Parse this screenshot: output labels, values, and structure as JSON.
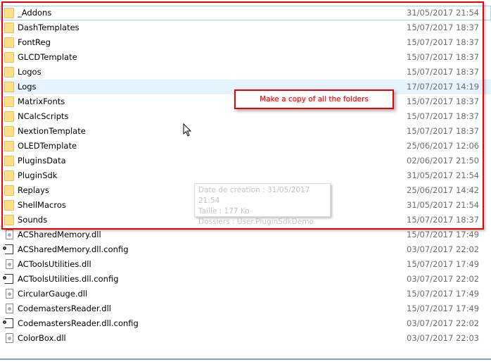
{
  "items": [
    {
      "name": "_Addons",
      "date": "31/05/2017 21:54",
      "type": "folder"
    },
    {
      "name": "DashTemplates",
      "date": "15/07/2017 18:37",
      "type": "folder"
    },
    {
      "name": "FontReg",
      "date": "15/07/2017 18:37",
      "type": "folder"
    },
    {
      "name": "GLCDTemplate",
      "date": "15/07/2017 18:37",
      "type": "folder"
    },
    {
      "name": "Logos",
      "date": "15/07/2017 18:37",
      "type": "folder"
    },
    {
      "name": "Logs",
      "date": "17/07/2017 14:19",
      "type": "folder"
    },
    {
      "name": "MatrixFonts",
      "date": "15/07/2017 18:37",
      "type": "folder"
    },
    {
      "name": "NCalcScripts",
      "date": "15/07/2017 18:37",
      "type": "folder"
    },
    {
      "name": "NextionTemplate",
      "date": "15/07/2017 18:37",
      "type": "folder"
    },
    {
      "name": "OLEDTemplate",
      "date": "25/06/2017 12:06",
      "type": "folder"
    },
    {
      "name": "PluginsData",
      "date": "02/06/2017 21:50",
      "type": "folder"
    },
    {
      "name": "PluginSdk",
      "date": "31/05/2017 21:54",
      "type": "folder"
    },
    {
      "name": "Replays",
      "date": "25/06/2017 14:42",
      "type": "folder"
    },
    {
      "name": "ShellMacros",
      "date": "31/05/2017 21:54",
      "type": "folder"
    },
    {
      "name": "Sounds",
      "date": "15/07/2017 18:37",
      "type": "folder"
    },
    {
      "name": "ACSharedMemory.dll",
      "date": "15/07/2017 17:49",
      "type": "dll"
    },
    {
      "name": "ACSharedMemory.dll.config",
      "date": "03/07/2017 22:02",
      "type": "config"
    },
    {
      "name": "ACToolsUtilities.dll",
      "date": "15/07/2017 17:49",
      "type": "dll"
    },
    {
      "name": "ACToolsUtilities.dll.config",
      "date": "03/07/2017 22:02",
      "type": "config"
    },
    {
      "name": "CircularGauge.dll",
      "date": "15/07/2017 17:49",
      "type": "dll"
    },
    {
      "name": "CodemastersReader.dll",
      "date": "15/07/2017 17:49",
      "type": "dll"
    },
    {
      "name": "CodemastersReader.dll.config",
      "date": "03/07/2017 22:02",
      "type": "config"
    },
    {
      "name": "ColorBox.dll",
      "date": "03/07/2017 22:03",
      "type": "dll"
    }
  ],
  "annotation": "Make a copy of all the folders",
  "tooltip": {
    "line1": "Date de création : 31/05/2017 21:54",
    "line2": "Taille : 177 Ko",
    "line3": "Dossiers : User.PluginSdkDemo"
  }
}
